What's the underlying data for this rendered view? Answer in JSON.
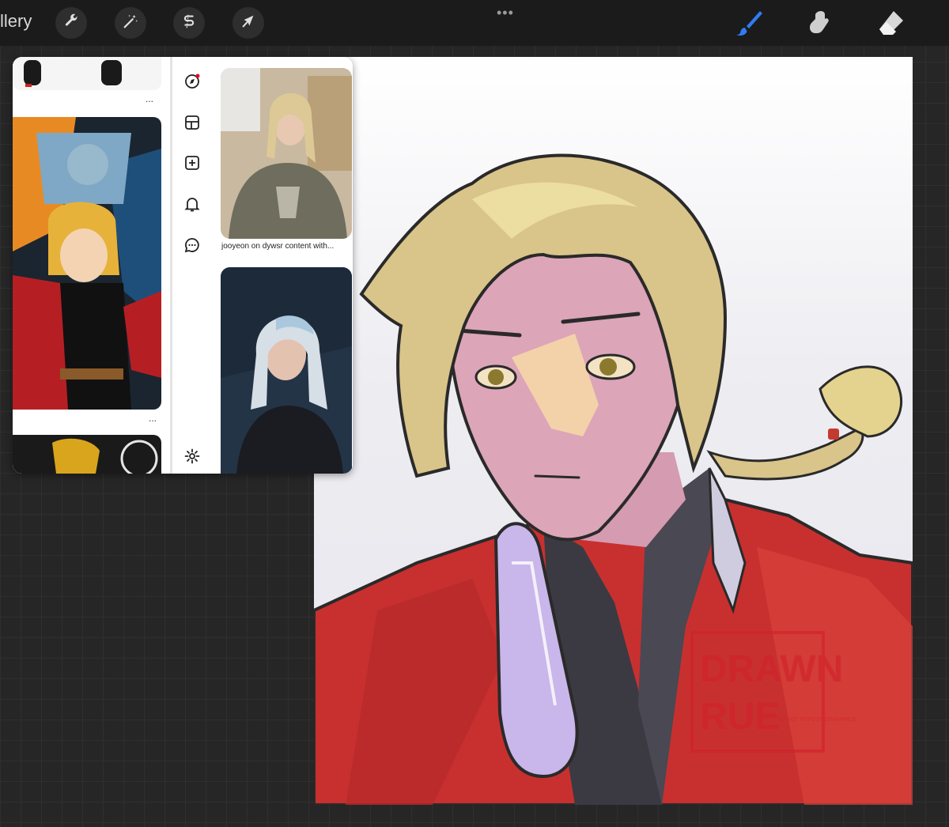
{
  "toolbar": {
    "gallery_label": "llery",
    "more_label": "•••",
    "left_tools": [
      {
        "name": "wrench-icon"
      },
      {
        "name": "magic-wand-icon"
      },
      {
        "name": "selection-s-icon"
      },
      {
        "name": "transform-arrow-icon"
      }
    ],
    "right_tools": [
      {
        "name": "brush-icon",
        "active_color": "#2f7cf6"
      },
      {
        "name": "smudge-icon"
      },
      {
        "name": "eraser-icon"
      }
    ]
  },
  "reference_panel": {
    "more_dots_label": "...",
    "caption": "jooyeon on dywsr content with...",
    "nav_icons": [
      "explore-icon",
      "boards-icon",
      "create-icon",
      "notifications-icon",
      "messages-icon",
      "settings-icon"
    ]
  },
  "canvas": {
    "watermark": {
      "line1": "DRAWN",
      "line2": "RUE",
      "small_text": "DO NOT REPOST DRAWNRUE"
    }
  },
  "colors": {
    "app_bg": "#262626",
    "toolbar_bg": "#1b1b1b",
    "accent": "#2f7cf6",
    "coat_red": "#c8302f",
    "glove_lavender": "#c9b6ea",
    "hair_blonde": "#d9c48a"
  }
}
